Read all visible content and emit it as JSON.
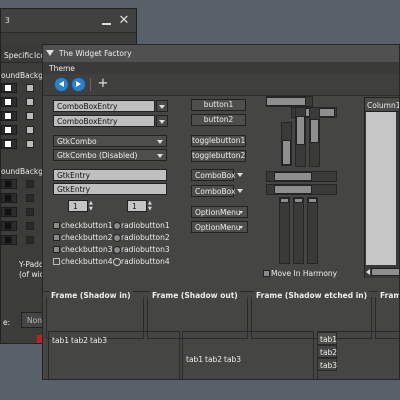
{
  "back_window": {
    "title_char": "3",
    "tabs": {
      "specific": "Specific",
      "icons": "Ico"
    },
    "headers": {
      "bound_1": "ound",
      "background_1": "Backg",
      "bound_2": "ound",
      "background_2": "Backg"
    },
    "ypad_line1": "Y-Padd",
    "ypad_line2": "(of wid",
    "field_label": "e:",
    "field_value": "Non"
  },
  "front_window": {
    "title": "The Widget Factory",
    "menu": {
      "theme": "Theme"
    },
    "column1": {
      "combo_entry_1": "ComboBoxEntry",
      "combo_entry_2": "ComboBoxEntry",
      "gtk_combo": "GtkCombo",
      "gtk_combo_disabled": "GtkCombo (Disabled)",
      "entry_1": "GtkEntry",
      "entry_2": "GtkEntry",
      "spin_1": "1",
      "spin_2": "1",
      "checkbuttons": [
        "checkbutton1",
        "checkbutton2",
        "checkbutton3",
        "checkbutton4"
      ],
      "radiobuttons": [
        "radiobutton1",
        "radiobutton2",
        "radiobutton3",
        "radiobutton4"
      ]
    },
    "column2": {
      "button1": "button1",
      "button2": "button2",
      "togglebutton1": "togglebutton1",
      "togglebutton2": "togglebutton2",
      "combobox_1": "ComboBox",
      "combobox_2": "ComboBox",
      "optionmenu_1": "OptionMenu",
      "optionmenu_2": "OptionMenu"
    },
    "move_in_harmony": "Move In Harmony",
    "tree": {
      "column_header": "Column1"
    },
    "frames": {
      "shadow_in": "Frame (Shadow in)",
      "shadow_out": "Frame (Shadow out)",
      "shadow_etched_in": "Frame (Shadow etched in)",
      "truncated": "Frame"
    },
    "notebooks": {
      "top_tabs": [
        "tab1",
        "tab2",
        "tab3"
      ],
      "bottom_tabs": [
        "tab1",
        "tab2",
        "tab3"
      ],
      "side_tabs": [
        "tab1",
        "tab2",
        "tab3"
      ]
    }
  }
}
